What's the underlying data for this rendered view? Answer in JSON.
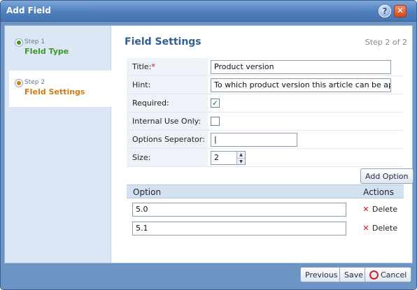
{
  "window": {
    "title": "Add Field",
    "help_glyph": "?",
    "close_glyph": "✕"
  },
  "steps": [
    {
      "number": "Step 1",
      "name": "FIeld Type",
      "color": "#3a9a25"
    },
    {
      "number": "Step 2",
      "name": "FIeld Settings",
      "color": "#d67a10"
    }
  ],
  "main": {
    "heading": "Field Settings",
    "step_count": "Step 2 of 2"
  },
  "form": {
    "title_label": "Title:",
    "title_required_mark": "*",
    "title_value": "Product version",
    "hint_label": "Hint:",
    "hint_value": "To which product version this article can be ap",
    "required_label": "Required:",
    "required_checked": true,
    "internal_label": "Internal Use Only:",
    "internal_checked": false,
    "separator_label": "Options Seperator:",
    "separator_value": "|",
    "size_label": "Size:",
    "size_value": "2"
  },
  "options": {
    "add_button": "Add Option",
    "col_option": "Option",
    "col_actions": "Actions",
    "rows": [
      {
        "value": "5.0",
        "delete_label": "Delete"
      },
      {
        "value": "5.1",
        "delete_label": "Delete"
      }
    ]
  },
  "footer": {
    "previous": "Previous",
    "save": "Save",
    "cancel": "Cancel"
  }
}
